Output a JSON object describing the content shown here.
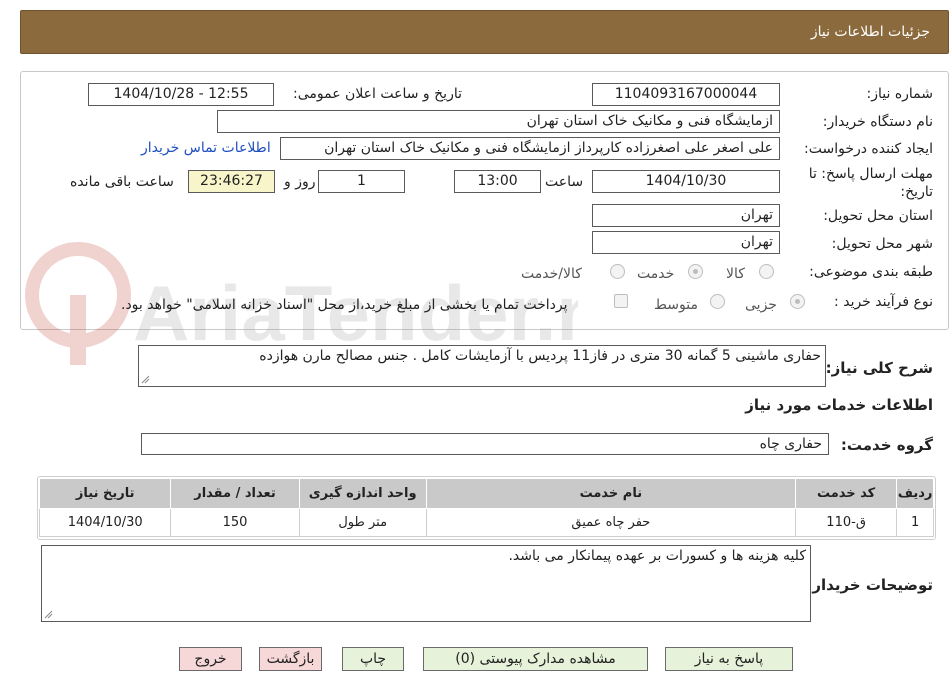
{
  "header": {
    "title": "جزئیات اطلاعات نیاز"
  },
  "form": {
    "need_number_label": "شماره نیاز:",
    "need_number": "1104093167000044",
    "announce_label": "تاریخ و ساعت اعلان عمومی:",
    "announce_value": "1404/10/28 - 12:55",
    "buyer_org_label": "نام دستگاه خریدار:",
    "buyer_org": "ازمایشگاه فنی و مکانیک خاک استان تهران",
    "requester_label": "ایجاد کننده درخواست:",
    "requester": "علی اصغر علی اصغرزاده کارپرداز ازمایشگاه فنی و مکانیک خاک استان تهران",
    "contact_link": "اطلاعات تماس خریدار",
    "deadline_label_1": "مهلت ارسال پاسخ: تا",
    "deadline_label_2": "تاریخ:",
    "deadline_date": "1404/10/30",
    "time_label": "ساعت",
    "deadline_time": "13:00",
    "days_value": "1",
    "days_label": "روز و",
    "remaining_time": "23:46:27",
    "remaining_label": "ساعت باقی مانده",
    "province_label": "استان محل تحویل:",
    "province": "تهران",
    "city_label": "شهر محل تحویل:",
    "city": "تهران",
    "category_label": "طبقه بندی موضوعی:",
    "category_options": [
      "کالا",
      "خدمت",
      "کالا/خدمت"
    ],
    "category_selected": "خدمت",
    "process_label": "نوع فرآیند خرید :",
    "process_options": [
      "جزیی",
      "متوسط"
    ],
    "process_selected": "جزیی",
    "payment_note": "پرداخت تمام یا بخشی از مبلغ خرید،از محل \"اسناد خزانه اسلامی\" خواهد بود."
  },
  "description": {
    "label": "شرح کلی نیاز:",
    "text": "حفاری ماشینی 5 گمانه 30 متری در فاز11 پردیس با آزمایشات کامل . جنس مصالح مارن هوازده"
  },
  "services": {
    "section_title": "اطلاعات خدمات مورد نیاز",
    "group_label": "گروه خدمت:",
    "group_value": "حفاری چاه",
    "columns": [
      "ردیف",
      "کد خدمت",
      "نام خدمت",
      "واحد اندازه گیری",
      "تعداد / مقدار",
      "تاریخ نیاز"
    ],
    "rows": [
      [
        "1",
        "ق-110",
        "حفر چاه عمیق",
        "متر طول",
        "150",
        "1404/10/30"
      ]
    ]
  },
  "buyer_notes": {
    "label": "توضیحات خریدار:",
    "text": "کلیه هزینه ها و کسورات بر عهده پیمانکار می باشد."
  },
  "buttons": {
    "reply": "پاسخ به نیاز",
    "attachments": "مشاهده مدارک پیوستی (0)",
    "print": "چاپ",
    "back": "بازگشت",
    "exit": "خروج"
  },
  "watermark": {
    "text": "AriaTender.neT"
  },
  "colors": {
    "header": "#8b6b3e",
    "button_green": "#e6f2d9",
    "button_pink": "#f6d8d8",
    "table_header": "#c9c9c9",
    "link": "#1f4fbf"
  }
}
